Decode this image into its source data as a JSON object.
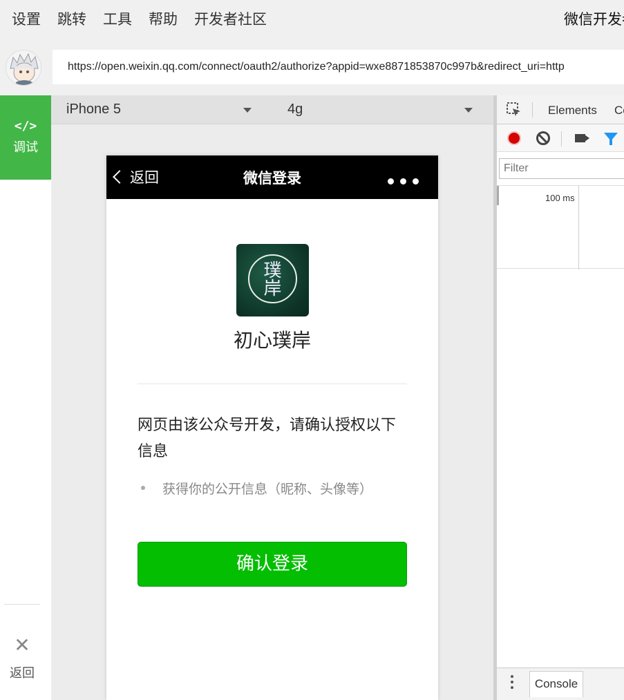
{
  "menu": {
    "items": [
      "设置",
      "跳转",
      "工具",
      "帮助",
      "开发者社区"
    ],
    "app_title": "微信开发者"
  },
  "address_bar": {
    "url": "https://open.weixin.qq.com/connect/oauth2/authorize?appid=wxe8871853870c997b&redirect_uri=http"
  },
  "sidebar": {
    "debug_icon": "</>",
    "debug_label": "调试",
    "back_label": "返回"
  },
  "simulator": {
    "device": "iPhone 5",
    "network": "4g"
  },
  "phone": {
    "nav_back": "返回",
    "nav_title": "微信登录",
    "logo_text": "璞\n岸",
    "org_name": "初心璞岸",
    "notice": "网页由该公众号开发，请确认授权以下信息",
    "permission": "获得你的公开信息（昵称、头像等）",
    "confirm_button": "确认登录"
  },
  "devtools": {
    "tab_elements": "Elements",
    "tab_console_partial": "Co",
    "filter_placeholder": "Filter",
    "timeline_label": "100 ms",
    "bottom_console_tab": "Console"
  },
  "colors": {
    "wechat_green": "#04be02",
    "sidebar_green": "#43b648",
    "record_red": "#d50000",
    "filter_blue": "#2196f3"
  }
}
